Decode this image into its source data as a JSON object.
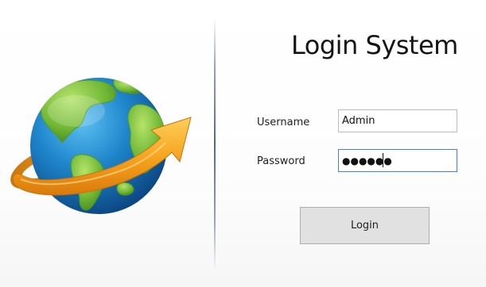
{
  "window": {
    "title": "Login System"
  },
  "logo": {
    "icon": "globe-with-arrow-icon",
    "colors": {
      "ocean": "#1f7fc4",
      "land": "#7cc23d",
      "arrow": "#f3a21f"
    }
  },
  "form": {
    "username_label": "Username",
    "username_value": "Admin",
    "password_label": "Password",
    "password_masked": "●●●●●●",
    "login_label": "Login"
  }
}
